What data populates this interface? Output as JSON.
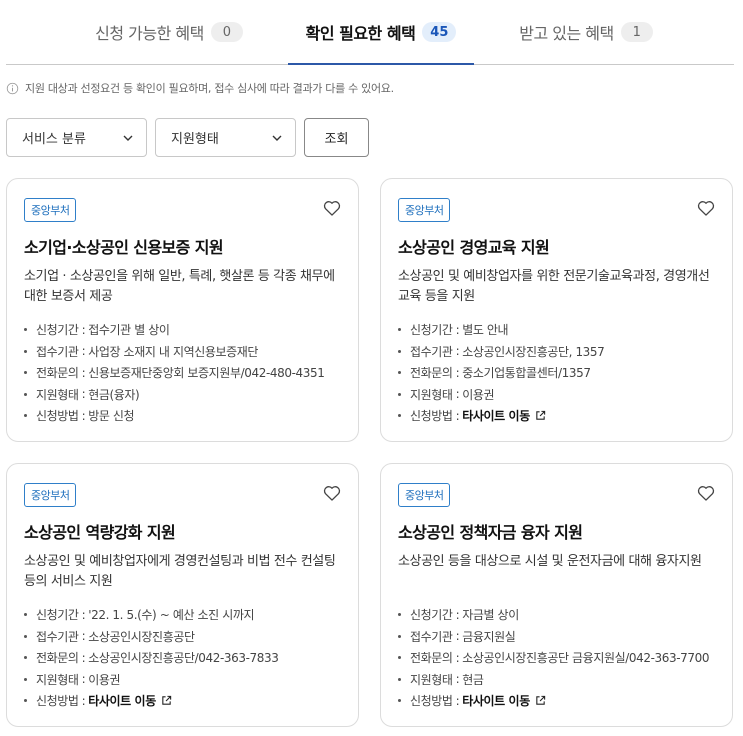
{
  "tabs": [
    {
      "label": "신청 가능한 혜택",
      "count": "0"
    },
    {
      "label": "확인 필요한 혜택",
      "count": "45"
    },
    {
      "label": "받고 있는 혜택",
      "count": "1"
    }
  ],
  "active_tab": 1,
  "notice": "지원 대상과 선정요건 등 확인이 필요하며, 접수 심사에 따라 결과가 다를 수 있어요.",
  "filters": {
    "service_category": "서비스 분류",
    "support_type": "지원형태",
    "search_button": "조회"
  },
  "field_labels": {
    "period": "신청기간",
    "agency": "접수기관",
    "phone": "전화문의",
    "support": "지원형태",
    "method": "신청방법"
  },
  "cards": [
    {
      "badge": "중앙부처",
      "title": "소기업·소상공인 신용보증 지원",
      "desc": "소기업 · 소상공인을 위해 일반, 특례, 햇살론 등 각종 채무에 대한 보증서 제공",
      "period": "접수기관 별 상이",
      "agency": "사업장 소재지 내 지역신용보증재단",
      "phone": "신용보증재단중앙회 보증지원부/042-480-4351",
      "support": "현금(융자)",
      "method": "방문 신청"
    },
    {
      "badge": "중앙부처",
      "title": "소상공인 경영교육 지원",
      "desc": "소상공인 및 예비창업자를 위한 전문기술교육과정, 경영개선교육 등을 지원",
      "period": "별도 안내",
      "agency": "소상공인시장진흥공단, 1357",
      "phone": "중소기업통합콜센터/1357",
      "support": "이용권",
      "method": "타사이트 이동"
    },
    {
      "badge": "중앙부처",
      "title": "소상공인 역량강화 지원",
      "desc": "소상공인 및 예비창업자에게 경영컨설팅과 비법 전수 컨설팅 등의 서비스 지원",
      "period": "'22. 1. 5.(수) ~ 예산 소진 시까지",
      "agency": "소상공인시장진흥공단",
      "phone": "소상공인시장진흥공단/042-363-7833",
      "support": "이용권",
      "method": "타사이트 이동"
    },
    {
      "badge": "중앙부처",
      "title": "소상공인 정책자금 융자 지원",
      "desc": "소상공인 등을 대상으로 시설 및 운전자금에 대해 융자지원",
      "period": "자금별 상이",
      "agency": "금융지원실",
      "phone": "소상공인시장진흥공단 금융지원실/042-363-7700",
      "support": "현금",
      "method": "타사이트 이동"
    }
  ],
  "colors": {
    "accent": "#2c58a8",
    "badge": "#2f7fc9",
    "active_count_bg": "#e3eefb"
  },
  "icons": {
    "info": "info-circle-icon",
    "chevron": "chevron-down-icon",
    "heart": "heart-outline-icon",
    "external": "external-link-icon"
  }
}
